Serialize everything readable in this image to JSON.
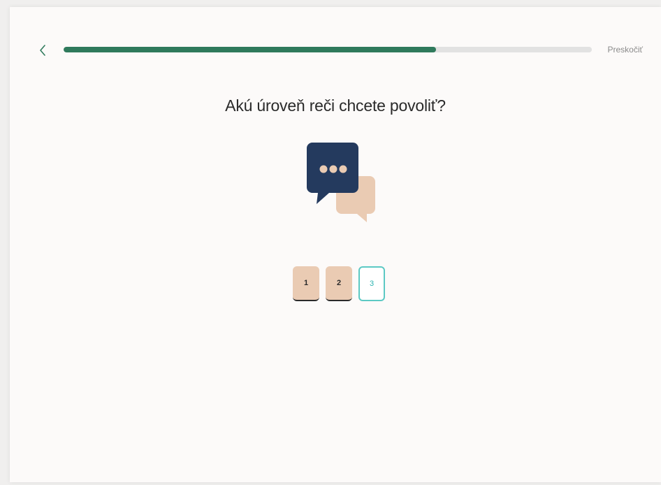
{
  "header": {
    "back_icon": "chevron-left-icon",
    "progress_fraction": 0.705,
    "progress_color": "#2f7a5c",
    "skip_label": "Preskočiť"
  },
  "main": {
    "question": "Akú úroveň reči chcete povoliť?",
    "illustration_icon": "speech-bubbles-icon",
    "levels": [
      {
        "label": "1",
        "state": "filled"
      },
      {
        "label": "2",
        "state": "filled"
      },
      {
        "label": "3",
        "state": "selected"
      }
    ]
  },
  "colors": {
    "navy": "#243a5e",
    "peach": "#eacbb3",
    "teal": "#5cc9c4",
    "green": "#2f7a5c"
  }
}
